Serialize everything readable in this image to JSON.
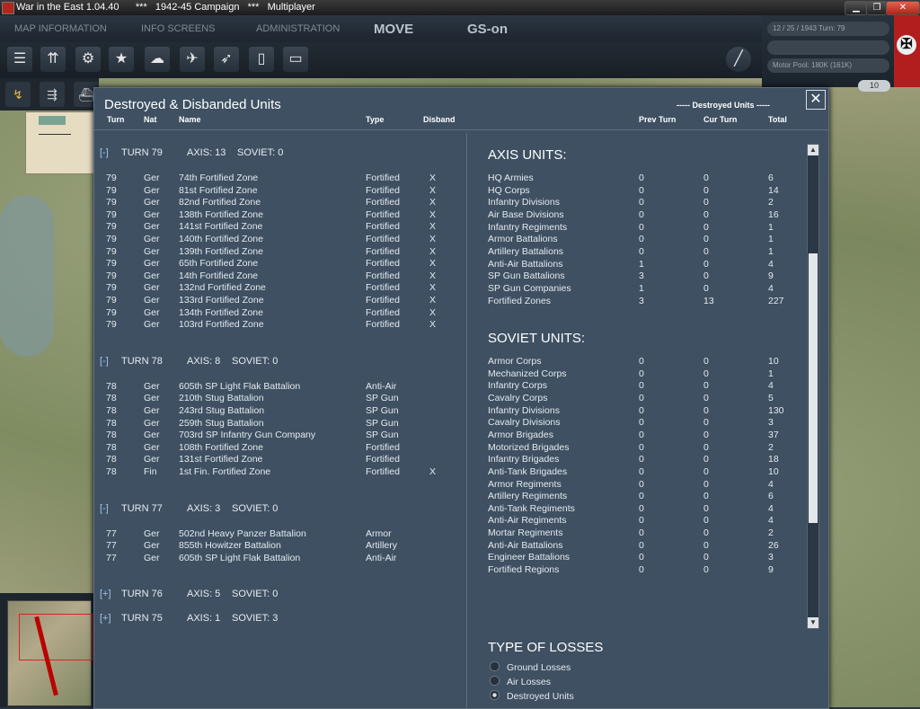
{
  "titlebar": {
    "text": "War in the East 1.04.40      ***   1942-45 Campaign   ***   Multiplayer"
  },
  "menu": {
    "map_info": "MAP INFORMATION",
    "info_screens": "INFO SCREENS",
    "administration": "ADMINISTRATION",
    "move": "MOVE",
    "gs_on": "GS-on"
  },
  "info": {
    "date_turn": "12 / 25 / 1943    Turn: 79",
    "motor_pool": "Motor Pool: 180K (161K)",
    "counter": "10"
  },
  "dialog": {
    "title": "Destroyed & Disbanded Units",
    "mode_label": "----- Destroyed Units -----",
    "close": "✕",
    "headers": {
      "turn": "Turn",
      "nat": "Nat",
      "name": "Name",
      "type": "Type",
      "disband": "Disband",
      "prev_turn": "Prev Turn",
      "cur_turn": "Cur Turn",
      "total": "Total"
    }
  },
  "turns": [
    {
      "toggle": "[-]",
      "label": "TURN 79",
      "axis": "AXIS: 13",
      "soviet": "SOVIET: 0",
      "rows": [
        {
          "turn": "79",
          "nat": "Ger",
          "name": "74th Fortified Zone",
          "type": "Fortified",
          "disband": "X"
        },
        {
          "turn": "79",
          "nat": "Ger",
          "name": "81st Fortified Zone",
          "type": "Fortified",
          "disband": "X"
        },
        {
          "turn": "79",
          "nat": "Ger",
          "name": "82nd Fortified Zone",
          "type": "Fortified",
          "disband": "X"
        },
        {
          "turn": "79",
          "nat": "Ger",
          "name": "138th Fortified Zone",
          "type": "Fortified",
          "disband": "X"
        },
        {
          "turn": "79",
          "nat": "Ger",
          "name": "141st Fortified Zone",
          "type": "Fortified",
          "disband": "X"
        },
        {
          "turn": "79",
          "nat": "Ger",
          "name": "140th Fortified Zone",
          "type": "Fortified",
          "disband": "X"
        },
        {
          "turn": "79",
          "nat": "Ger",
          "name": "139th Fortified Zone",
          "type": "Fortified",
          "disband": "X"
        },
        {
          "turn": "79",
          "nat": "Ger",
          "name": "65th Fortified Zone",
          "type": "Fortified",
          "disband": "X"
        },
        {
          "turn": "79",
          "nat": "Ger",
          "name": "14th Fortified Zone",
          "type": "Fortified",
          "disband": "X"
        },
        {
          "turn": "79",
          "nat": "Ger",
          "name": "132nd Fortified Zone",
          "type": "Fortified",
          "disband": "X"
        },
        {
          "turn": "79",
          "nat": "Ger",
          "name": "133rd Fortified Zone",
          "type": "Fortified",
          "disband": "X"
        },
        {
          "turn": "79",
          "nat": "Ger",
          "name": "134th Fortified Zone",
          "type": "Fortified",
          "disband": "X"
        },
        {
          "turn": "79",
          "nat": "Ger",
          "name": "103rd Fortified Zone",
          "type": "Fortified",
          "disband": "X"
        }
      ]
    },
    {
      "toggle": "[-]",
      "label": "TURN 78",
      "axis": "AXIS: 8",
      "soviet": "SOVIET: 0",
      "rows": [
        {
          "turn": "78",
          "nat": "Ger",
          "name": "605th SP Light Flak Battalion",
          "type": "Anti-Air",
          "disband": ""
        },
        {
          "turn": "78",
          "nat": "Ger",
          "name": "210th Stug Battalion",
          "type": "SP Gun",
          "disband": ""
        },
        {
          "turn": "78",
          "nat": "Ger",
          "name": "243rd Stug Battalion",
          "type": "SP Gun",
          "disband": ""
        },
        {
          "turn": "78",
          "nat": "Ger",
          "name": "259th Stug Battalion",
          "type": "SP Gun",
          "disband": ""
        },
        {
          "turn": "78",
          "nat": "Ger",
          "name": "703rd SP Infantry Gun Company",
          "type": "SP Gun",
          "disband": ""
        },
        {
          "turn": "78",
          "nat": "Ger",
          "name": "108th Fortified Zone",
          "type": "Fortified",
          "disband": ""
        },
        {
          "turn": "78",
          "nat": "Ger",
          "name": "131st Fortified Zone",
          "type": "Fortified",
          "disband": ""
        },
        {
          "turn": "78",
          "nat": "Fin",
          "name": "1st Fin. Fortified Zone",
          "type": "Fortified",
          "disband": "X"
        }
      ]
    },
    {
      "toggle": "[-]",
      "label": "TURN 77",
      "axis": "AXIS: 3",
      "soviet": "SOVIET: 0",
      "rows": [
        {
          "turn": "77",
          "nat": "Ger",
          "name": "502nd Heavy Panzer Battalion",
          "type": "Armor",
          "disband": ""
        },
        {
          "turn": "77",
          "nat": "Ger",
          "name": "855th Howitzer Battalion",
          "type": "Artillery",
          "disband": ""
        },
        {
          "turn": "77",
          "nat": "Ger",
          "name": "605th SP Light Flak Battalion",
          "type": "Anti-Air",
          "disband": ""
        }
      ]
    },
    {
      "toggle": "[+]",
      "label": "TURN 76",
      "axis": "AXIS: 5",
      "soviet": "SOVIET: 0",
      "rows": []
    },
    {
      "toggle": "[+]",
      "label": "TURN 75",
      "axis": "AXIS: 1",
      "soviet": "SOVIET: 3",
      "rows": []
    }
  ],
  "axis_units": {
    "title": "AXIS UNITS:",
    "rows": [
      {
        "name": "HQ Armies",
        "prev": "0",
        "cur": "0",
        "total": "6"
      },
      {
        "name": "HQ Corps",
        "prev": "0",
        "cur": "0",
        "total": "14"
      },
      {
        "name": "Infantry Divisions",
        "prev": "0",
        "cur": "0",
        "total": "2"
      },
      {
        "name": "Air Base Divisions",
        "prev": "0",
        "cur": "0",
        "total": "16"
      },
      {
        "name": "Infantry Regiments",
        "prev": "0",
        "cur": "0",
        "total": "1"
      },
      {
        "name": "Armor Battalions",
        "prev": "0",
        "cur": "0",
        "total": "1"
      },
      {
        "name": "Artillery Battalions",
        "prev": "0",
        "cur": "0",
        "total": "1"
      },
      {
        "name": "Anti-Air Battalions",
        "prev": "1",
        "cur": "0",
        "total": "4"
      },
      {
        "name": "SP Gun Battalions",
        "prev": "3",
        "cur": "0",
        "total": "9"
      },
      {
        "name": "SP Gun Companies",
        "prev": "1",
        "cur": "0",
        "total": "4"
      },
      {
        "name": "Fortified Zones",
        "prev": "3",
        "cur": "13",
        "total": "227"
      }
    ]
  },
  "soviet_units": {
    "title": "SOVIET UNITS:",
    "rows": [
      {
        "name": "Armor Corps",
        "prev": "0",
        "cur": "0",
        "total": "10"
      },
      {
        "name": "Mechanized Corps",
        "prev": "0",
        "cur": "0",
        "total": "1"
      },
      {
        "name": "Infantry Corps",
        "prev": "0",
        "cur": "0",
        "total": "4"
      },
      {
        "name": "Cavalry Corps",
        "prev": "0",
        "cur": "0",
        "total": "5"
      },
      {
        "name": "Infantry Divisions",
        "prev": "0",
        "cur": "0",
        "total": "130"
      },
      {
        "name": "Cavalry Divisions",
        "prev": "0",
        "cur": "0",
        "total": "3"
      },
      {
        "name": "Armor Brigades",
        "prev": "0",
        "cur": "0",
        "total": "37"
      },
      {
        "name": "Motorized Brigades",
        "prev": "0",
        "cur": "0",
        "total": "2"
      },
      {
        "name": "Infantry Brigades",
        "prev": "0",
        "cur": "0",
        "total": "18"
      },
      {
        "name": "Anti-Tank Brigades",
        "prev": "0",
        "cur": "0",
        "total": "10"
      },
      {
        "name": "Armor Regiments",
        "prev": "0",
        "cur": "0",
        "total": "4"
      },
      {
        "name": "Artillery Regiments",
        "prev": "0",
        "cur": "0",
        "total": "6"
      },
      {
        "name": "Anti-Tank Regiments",
        "prev": "0",
        "cur": "0",
        "total": "4"
      },
      {
        "name": "Anti-Air Regiments",
        "prev": "0",
        "cur": "0",
        "total": "4"
      },
      {
        "name": "Mortar Regiments",
        "prev": "0",
        "cur": "0",
        "total": "2"
      },
      {
        "name": "Anti-Air Battalions",
        "prev": "0",
        "cur": "0",
        "total": "26"
      },
      {
        "name": "Engineer Battalions",
        "prev": "0",
        "cur": "0",
        "total": "3"
      },
      {
        "name": "Fortified Regions",
        "prev": "0",
        "cur": "0",
        "total": "9"
      }
    ]
  },
  "losses": {
    "title": "TYPE OF LOSSES",
    "options": [
      {
        "label": "Ground Losses",
        "selected": false
      },
      {
        "label": "Air Losses",
        "selected": false
      },
      {
        "label": "Destroyed Units",
        "selected": true
      }
    ]
  },
  "icons": {
    "toolbar": [
      "layers-icon",
      "unit-stack-icon",
      "gear-icon",
      "star-icon",
      "weather-icon",
      "grid-icon",
      "air-icon",
      "rocket-icon",
      "fuel-icon",
      "supply-icon",
      "line-tool-icon"
    ]
  },
  "colors": {
    "dialog_bg": "#3e5062",
    "flag_red": "#b21e1e",
    "toggle_blue": "#9fc4e6"
  }
}
